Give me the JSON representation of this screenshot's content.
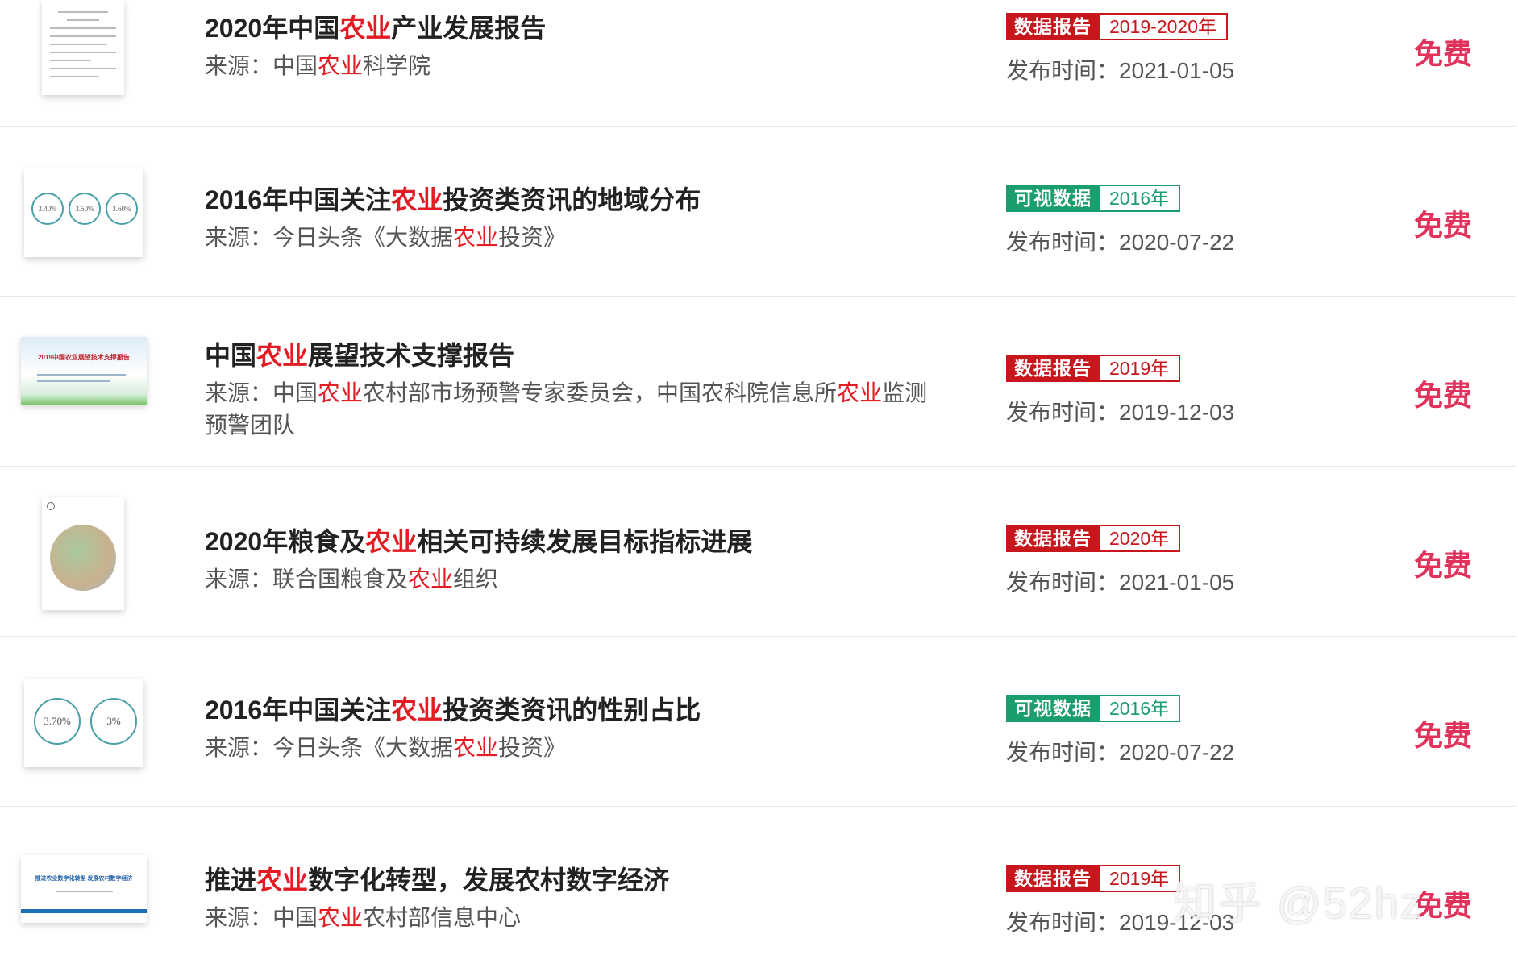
{
  "colors": {
    "keyword": "#e31b23",
    "report_tag": "#c8161d",
    "visual_tag": "#1a9e6e",
    "price": "#e0325a"
  },
  "items": [
    {
      "title": {
        "pre": "2020年中国",
        "kw": "农业",
        "post": "产业发展报告"
      },
      "source": {
        "label": "来源：",
        "segments": [
          {
            "t": "中国"
          },
          {
            "t": "农业",
            "kw": true
          },
          {
            "t": "科学院"
          }
        ]
      },
      "tag_type": "数据报告",
      "tag_year": "2019-2020年",
      "tag_color": "report",
      "published": "发布时间：2021-01-05",
      "price": "免费",
      "thumb_icon": "document-thumbnail"
    },
    {
      "title": {
        "pre": "2016年中国关注",
        "kw": "农业",
        "post": "投资类资讯的地域分布"
      },
      "source": {
        "label": "来源：",
        "segments": [
          {
            "t": "今日头条《大数据"
          },
          {
            "t": "农业",
            "kw": true
          },
          {
            "t": "投资》"
          }
        ]
      },
      "tag_type": "可视数据",
      "tag_year": "2016年",
      "tag_color": "visual",
      "published": "发布时间：2020-07-22",
      "price": "免费",
      "thumb_icon": "percent-circles-thumbnail",
      "thumb_values": [
        "3.40%",
        "3.50%",
        "3.60%"
      ]
    },
    {
      "title": {
        "pre": "中国",
        "kw": "农业",
        "post": "展望技术支撑报告"
      },
      "source": {
        "label": "来源：",
        "segments": [
          {
            "t": "中国"
          },
          {
            "t": "农业",
            "kw": true
          },
          {
            "t": "农村部市场预警专家委员会，中国农科院信息所"
          },
          {
            "t": "农业",
            "kw": true
          },
          {
            "t": "监测预警团队"
          }
        ]
      },
      "tag_type": "数据报告",
      "tag_year": "2019年",
      "tag_color": "report",
      "published": "发布时间：2019-12-03",
      "price": "免费",
      "thumb_icon": "report-cover-thumbnail",
      "thumb_text": "2019中国农业展望技术支撑报告"
    },
    {
      "title": {
        "pre": "2020年粮食及",
        "kw": "农业",
        "post": "相关可持续发展目标指标进展"
      },
      "source": {
        "label": "来源：",
        "segments": [
          {
            "t": "联合国粮食及"
          },
          {
            "t": "农业",
            "kw": true
          },
          {
            "t": "组织"
          }
        ]
      },
      "tag_type": "数据报告",
      "tag_year": "2020年",
      "tag_color": "report",
      "published": "发布时间：2021-01-05",
      "price": "免费",
      "thumb_icon": "fao-cover-thumbnail"
    },
    {
      "title": {
        "pre": "2016年中国关注",
        "kw": "农业",
        "post": "投资类资讯的性别占比"
      },
      "source": {
        "label": "来源：",
        "segments": [
          {
            "t": "今日头条《大数据"
          },
          {
            "t": "农业",
            "kw": true
          },
          {
            "t": "投资》"
          }
        ]
      },
      "tag_type": "可视数据",
      "tag_year": "2016年",
      "tag_color": "visual",
      "published": "发布时间：2020-07-22",
      "price": "免费",
      "thumb_icon": "percent-circles-thumbnail",
      "thumb_values": [
        "3.70%",
        "3%"
      ]
    },
    {
      "title": {
        "pre": "推进",
        "kw": "农业",
        "post": "数字化转型，发展农村数字经济"
      },
      "source": {
        "label": "来源：",
        "segments": [
          {
            "t": "中国"
          },
          {
            "t": "农业",
            "kw": true
          },
          {
            "t": "农村部信息中心"
          }
        ]
      },
      "tag_type": "数据报告",
      "tag_year": "2019年",
      "tag_color": "report",
      "published": "发布时间：2019-12-03",
      "price": "免费",
      "thumb_icon": "slide-cover-thumbnail",
      "thumb_text": "推进农业数字化转型 发展农村数字经济"
    }
  ],
  "watermark": "知乎 @52hz"
}
